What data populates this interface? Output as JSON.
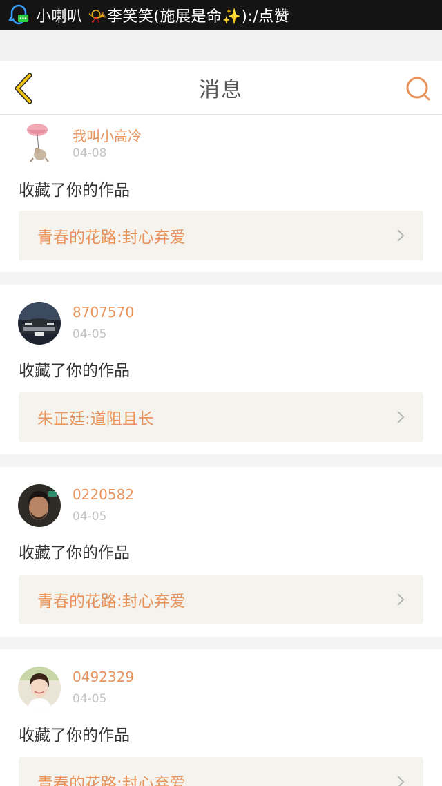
{
  "statusbar": {
    "notification": "小喇叭 📯李笑笑(施展是命✨):/点赞"
  },
  "header": {
    "title": "消息"
  },
  "notifications": [
    {
      "username": "我叫小高冷",
      "date": "04-08",
      "action": "收藏了你的作品",
      "work": "青春的花路:封心弃爱"
    },
    {
      "username": "8707570",
      "date": "04-05",
      "action": "收藏了你的作品",
      "work": "朱正廷:道阻且长"
    },
    {
      "username": "0220582",
      "date": "04-05",
      "action": "收藏了你的作品",
      "work": "青春的花路:封心弃爱"
    },
    {
      "username": "0492329",
      "date": "04-05",
      "action": "收藏了你的作品",
      "work": "青春的花路:封心弃爱"
    }
  ],
  "colors": {
    "accent": "#e8935b",
    "back_arrow": "#f0c419",
    "statusbar_bg": "#141414",
    "card_link_bg": "#f4f3ee"
  },
  "icons": {
    "back": "chevron-left-icon",
    "search": "search-icon",
    "row_arrow": "chevron-right-icon",
    "notification_app": "qq-icon"
  }
}
